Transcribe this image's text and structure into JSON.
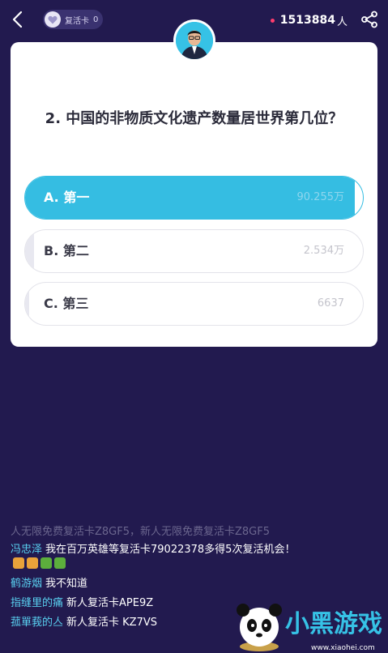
{
  "header": {
    "revive_label": "复活卡",
    "revive_count": "0",
    "online_count": "1513884",
    "online_unit": "人",
    "online_dot_color": "#ff3d6e"
  },
  "icons": {
    "back": "chevron-left-icon",
    "heart": "heart-icon",
    "share": "share-icon"
  },
  "question": {
    "text": "2. 中国的非物质文化遗产数量居世界第几位？"
  },
  "options": [
    {
      "label": "A. 第一",
      "votes": "90.255万",
      "share": 0.977,
      "selected": true
    },
    {
      "label": "B. 第二",
      "votes": "2.534万",
      "share": 0.027,
      "selected": false
    },
    {
      "label": "C. 第三",
      "votes": "6637",
      "share": 0.007,
      "selected": false
    }
  ],
  "chat": {
    "faded_line": "人无限免费复活卡Z8GF5，新人无限免费复活卡Z8GF5",
    "messages": [
      {
        "user": "冯忠泽",
        "text": "我在百万英雄等复活卡79022378多得5次复活机会！"
      },
      {
        "user": "鹤游烟",
        "text": "我不知道"
      },
      {
        "user": "指缝里的痛",
        "text": "新人复活卡APE9Z"
      },
      {
        "user": "菰單莪的亼",
        "text": "新人复活卡 KZ7VS"
      }
    ]
  },
  "colors": {
    "background": "#221a4f",
    "accent": "#35bde2",
    "username": "#59d0f0"
  },
  "watermark": {
    "title": "小黑游戏",
    "url": "www.xiaohei.com"
  }
}
